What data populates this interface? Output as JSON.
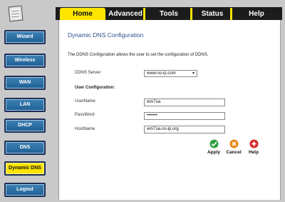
{
  "tabs": [
    {
      "label": "Home",
      "active": true
    },
    {
      "label": "Advanced",
      "active": false
    },
    {
      "label": "Tools",
      "active": false
    },
    {
      "label": "Status",
      "active": false
    },
    {
      "label": "Help",
      "active": false
    }
  ],
  "sidebar": {
    "items": [
      {
        "label": "Wizard"
      },
      {
        "label": "Wireless"
      },
      {
        "label": "WAN"
      },
      {
        "label": "LAN"
      },
      {
        "label": "DHCP"
      },
      {
        "label": "DNS"
      },
      {
        "label": "Dynamic DNS",
        "active": true
      },
      {
        "label": "Logout"
      }
    ]
  },
  "main": {
    "title": "Dynamic DNS Configuration",
    "description": "The DDNS Configuration allows the user to set the configuration of DDNS.",
    "ddns_server_label": "DDNS Server",
    "ddns_server_value": "www.no-ip.com",
    "user_config_label": "User Configuration:",
    "username_label": "UserName",
    "username_value": "wm7ua",
    "password_label": "PassWord",
    "password_value": "•••••••",
    "hostname_label": "HostName",
    "hostname_value": "wm7ua.no-ip.org"
  },
  "actions": {
    "apply": "Apply",
    "cancel": "Cancel",
    "help": "Help"
  },
  "colors": {
    "accent_yellow": "#fde500",
    "nav_blue": "#1f5f94",
    "title_blue": "#2b4f8a",
    "apply_green": "#2ea043",
    "cancel_orange": "#e8891a",
    "help_red": "#d62828"
  },
  "icons": {
    "logo": "router-logo-icon",
    "apply": "check-circle-icon",
    "cancel": "x-circle-icon",
    "help": "plus-circle-icon"
  }
}
